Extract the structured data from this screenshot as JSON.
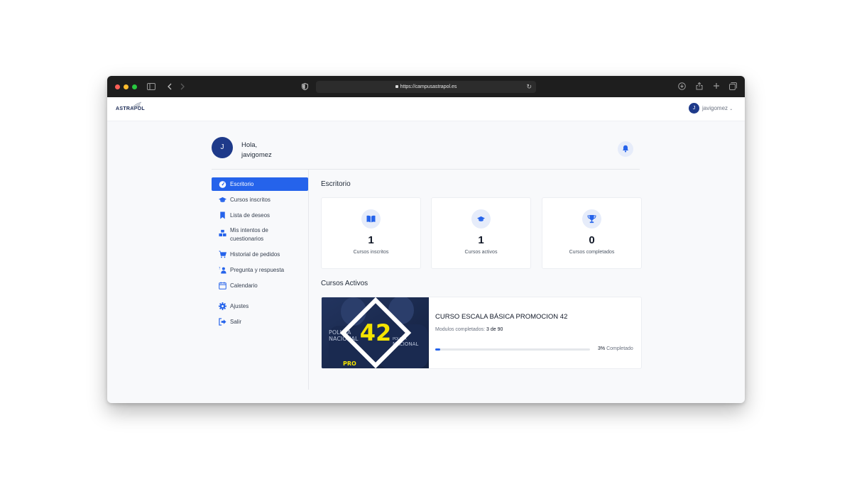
{
  "browser": {
    "url": "https://campusastrapol.es"
  },
  "site": {
    "logo_text": "ASTRAPOL",
    "user_avatar_initial": "J",
    "username": "javigomez"
  },
  "greeting": {
    "avatar_initial": "J",
    "line1": "Hola,",
    "line2": "javigomez"
  },
  "sidebar": {
    "items": [
      {
        "label": "Escritorio",
        "icon": "dashboard-icon",
        "active": true
      },
      {
        "label": "Cursos inscritos",
        "icon": "graduation-cap-icon"
      },
      {
        "label": "Lista de deseos",
        "icon": "bookmark-icon"
      },
      {
        "label": "Mis intentos de",
        "label2": "cuestionarios",
        "icon": "quiz-attempts-icon"
      },
      {
        "label": "Historial de pedidos",
        "icon": "cart-icon"
      },
      {
        "label": "Pregunta y respuesta",
        "icon": "qa-icon"
      },
      {
        "label": "Calendario",
        "icon": "calendar-icon"
      },
      {
        "label": "Ajustes",
        "icon": "gear-icon"
      },
      {
        "label": "Salir",
        "icon": "logout-icon"
      }
    ]
  },
  "dashboard": {
    "title": "Escritorio",
    "stats": [
      {
        "value": "1",
        "label": "Cursos inscritos",
        "icon": "book-open-icon"
      },
      {
        "value": "1",
        "label": "Cursos activos",
        "icon": "graduation-cap-icon"
      },
      {
        "value": "0",
        "label": "Cursos completados",
        "icon": "trophy-icon"
      }
    ]
  },
  "active_courses": {
    "title": "Cursos Activos",
    "course": {
      "thumb_number": "42",
      "thumb_text_left_1": "POLICÍA",
      "thumb_text_left_2": "NACIONAL",
      "thumb_text_right_1": "POLICÍA",
      "thumb_text_right_2": "NACIONAL",
      "thumb_badge": "PRO",
      "title": "CURSO ESCALA BÁSICA PROMOCION 42",
      "modules_label": "Modulos completados:",
      "modules_value": "3 de 90",
      "progress_percent": 3,
      "progress_pct_text": "3%",
      "progress_suffix": "Completado"
    }
  },
  "colors": {
    "accent": "#2563eb",
    "navy": "#1e3a8a",
    "icon_bg": "#e6ecfa",
    "thumb_yellow": "#f5e400"
  }
}
